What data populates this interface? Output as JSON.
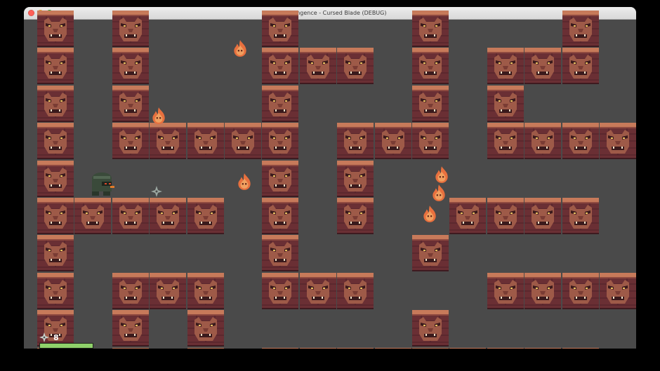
{
  "window": {
    "title": "Ninja Vengence - Cursed Blade (DEBUG)"
  },
  "hud": {
    "shuriken_count": "8",
    "health_fraction": 1.0,
    "health_color": "#8fd16a"
  },
  "colors": {
    "floor": "#4a4a4a",
    "wall_brick": "#7a3a3a",
    "wall_face": "#9a5547",
    "flame": "#e86a3a",
    "ninja": "#3c4a3c",
    "close_button": "#ff5f57",
    "minimize_button": "#febc2e",
    "maximize_button": "#28c840"
  },
  "entities": {
    "player": "ninja-icon",
    "projectile": "shuriken-icon",
    "enemy": "flame-spirit-icon",
    "wall": "demon-face-wall-block"
  }
}
